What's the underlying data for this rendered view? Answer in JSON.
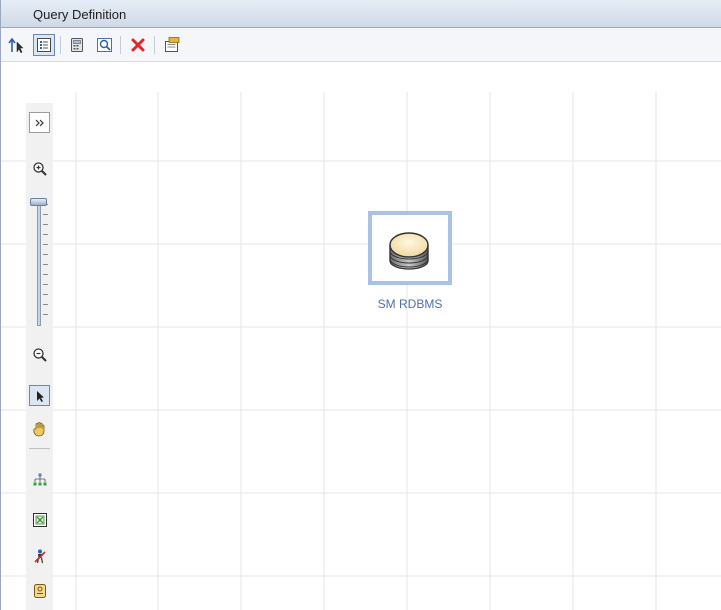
{
  "panel": {
    "title": "Query Definition"
  },
  "toolbar": {
    "buttons": [
      {
        "icon": "up-arrow-cursor-icon"
      },
      {
        "icon": "properties-list-icon",
        "selected": true
      },
      {
        "icon": "calculator-icon"
      },
      {
        "icon": "preview-icon"
      },
      {
        "icon": "delete-icon"
      },
      {
        "icon": "edit-properties-icon"
      }
    ]
  },
  "sidebar": {
    "tools": [
      "expand-icon",
      "zoom-in-icon",
      "zoom-slider",
      "zoom-out-icon",
      "select-pointer-icon",
      "pan-hand-icon",
      "hierarchy-layout-icon",
      "fit-to-window-icon",
      "hide-person-icon",
      "id-badge-icon"
    ],
    "zoom_level": 1.0
  },
  "node": {
    "label": "SM RDBMS",
    "icon": "database-icon"
  },
  "colors": {
    "node_label": "#4a6fb0",
    "node_highlight": "#a9c2e4",
    "grid": "#e6e6e6"
  }
}
